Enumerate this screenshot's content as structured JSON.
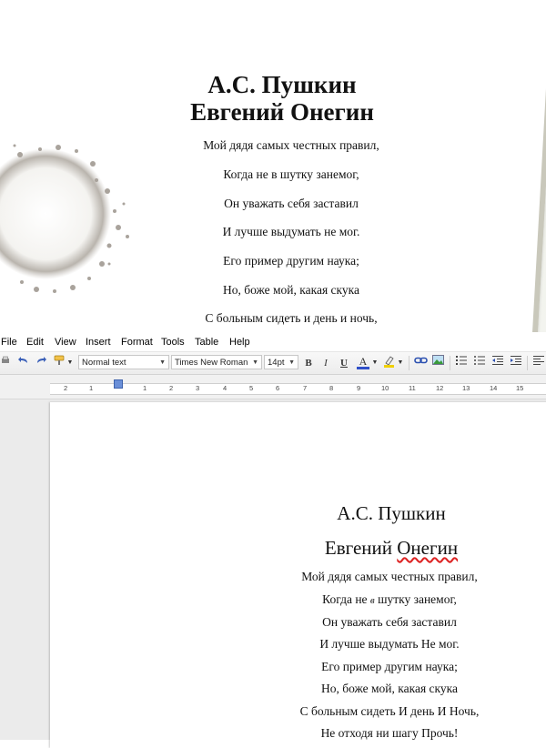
{
  "photo": {
    "title_line1": "А.С. Пушкин",
    "title_line2": "Евгений Онегин",
    "lines": [
      "Мой дядя самых честных правил,",
      "Когда не в шутку занемог,",
      "Он уважать себя заставил",
      "И лучше выдумать не мог.",
      "Его пример другим наука;",
      "Но, боже мой, какая скука",
      "С больным сидеть и день и ночь,"
    ]
  },
  "menu": [
    "File",
    "Edit",
    "View",
    "Insert",
    "Format",
    "Tools",
    "Table",
    "Help"
  ],
  "toolbar": {
    "style_value": "Normal text",
    "font_value": "Times New Roman",
    "size_value": "14pt",
    "bold": "B",
    "italic": "I",
    "underline": "U",
    "text_color": "A"
  },
  "ruler": {
    "numbers": [
      "2",
      "1",
      "1",
      "2",
      "3",
      "4",
      "5",
      "6",
      "7",
      "8",
      "9",
      "10",
      "11",
      "12",
      "13",
      "14",
      "15"
    ]
  },
  "document": {
    "title_line1": "А.С. Пушкин",
    "title_line2": "Евгений Онегин",
    "line1": "Мой дядя самых честных правил,",
    "line2_a": "Когда не ",
    "line2_b": "в",
    "line2_c": " шутку занемог,",
    "line3": "Он уважать себя заставил",
    "line4": "И лучше выдумать Не мог.",
    "line5": "Его пример другим наука;",
    "line6": "Но, боже мой, какая скука",
    "line7": "С больным сидеть И день И Ночь,",
    "line8": "Не отходя ни шагу Прочь!"
  },
  "colors": {
    "text_color_swatch": "#3050c8",
    "highlight_swatch": "#f0d000",
    "spell_underline": "#dd2222"
  }
}
